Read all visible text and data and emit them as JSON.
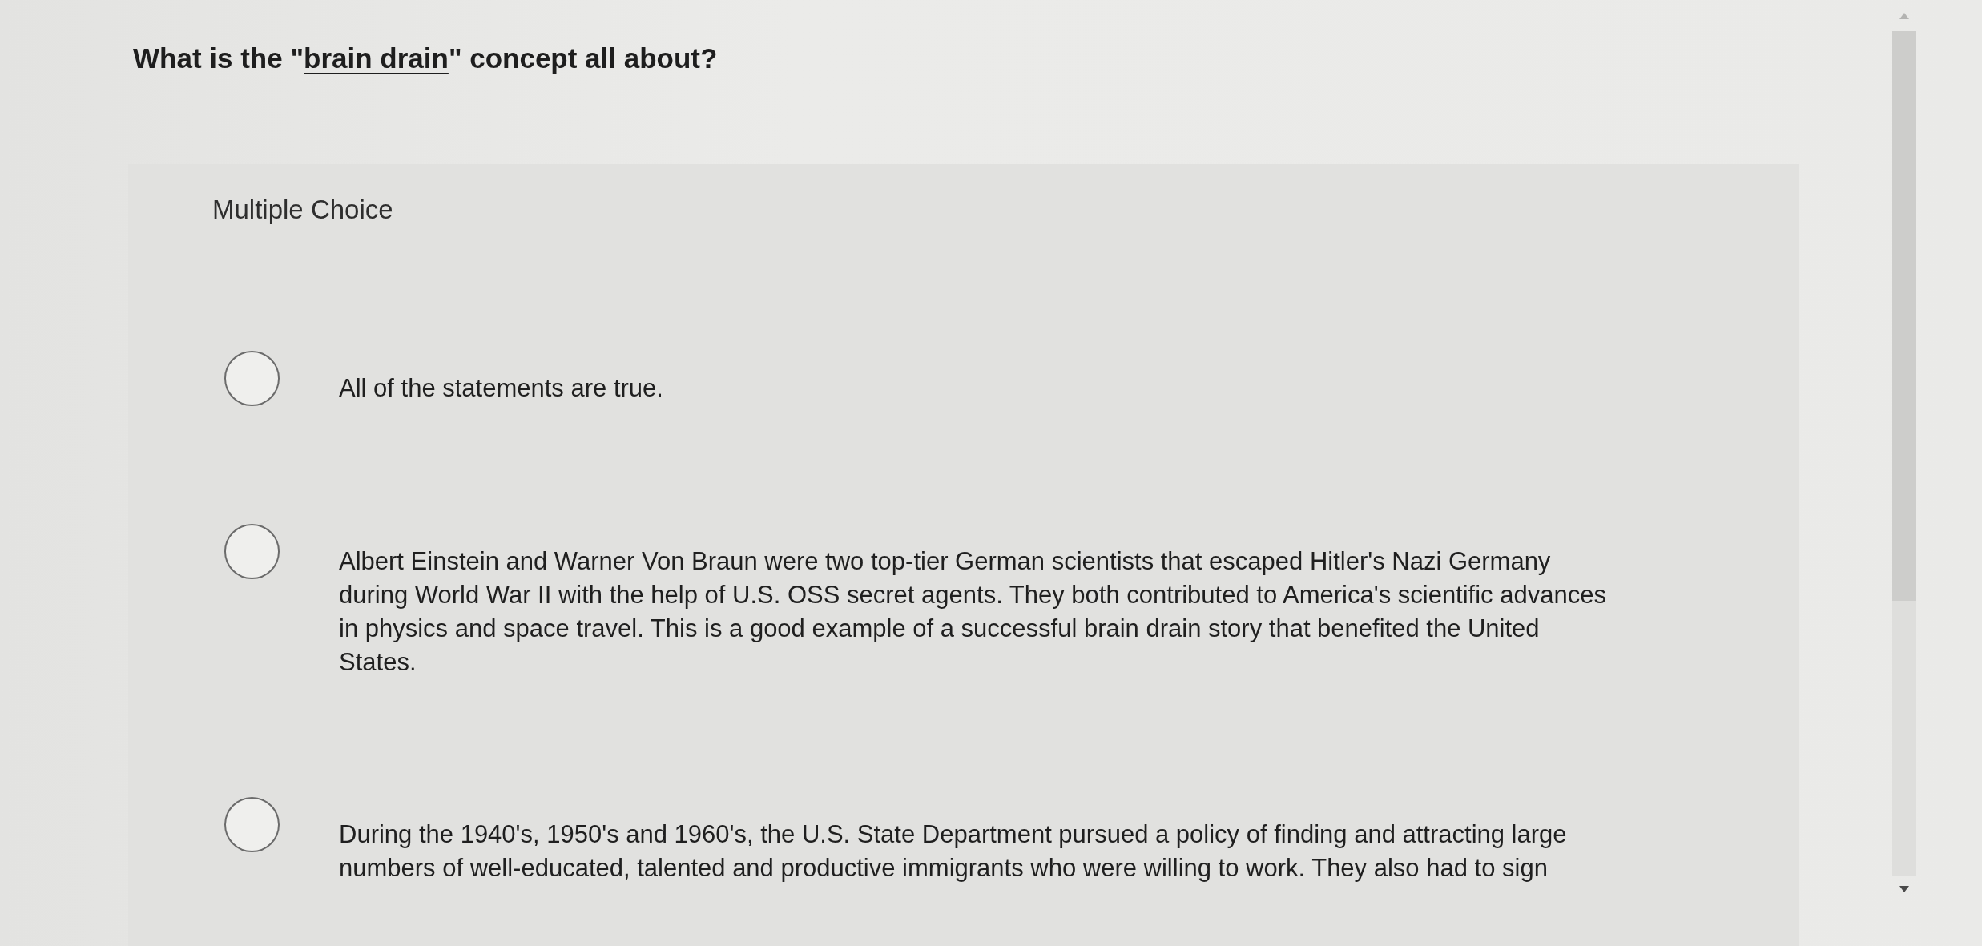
{
  "question": {
    "text_before": "What is the \"",
    "term": "brain drain",
    "text_after": "\" concept all about?"
  },
  "answer_area": {
    "type_label": "Multiple Choice",
    "options": [
      {
        "text": "All of the statements are true.",
        "selected": false
      },
      {
        "text": "Albert Einstein and Warner Von Braun were two top-tier German scientists that escaped Hitler's Nazi Germany during World War II with the help of U.S. OSS secret agents. They both contributed to America's scientific advances in physics and space travel. This is a good example of a successful brain drain story that benefited the United States.",
        "selected": false
      },
      {
        "text": "During the 1940's, 1950's and 1960's, the U.S. State Department pursued a policy of finding and attracting large numbers of well-educated, talented and productive immigrants who were willing to work. They also had to sign",
        "selected": false
      }
    ]
  }
}
